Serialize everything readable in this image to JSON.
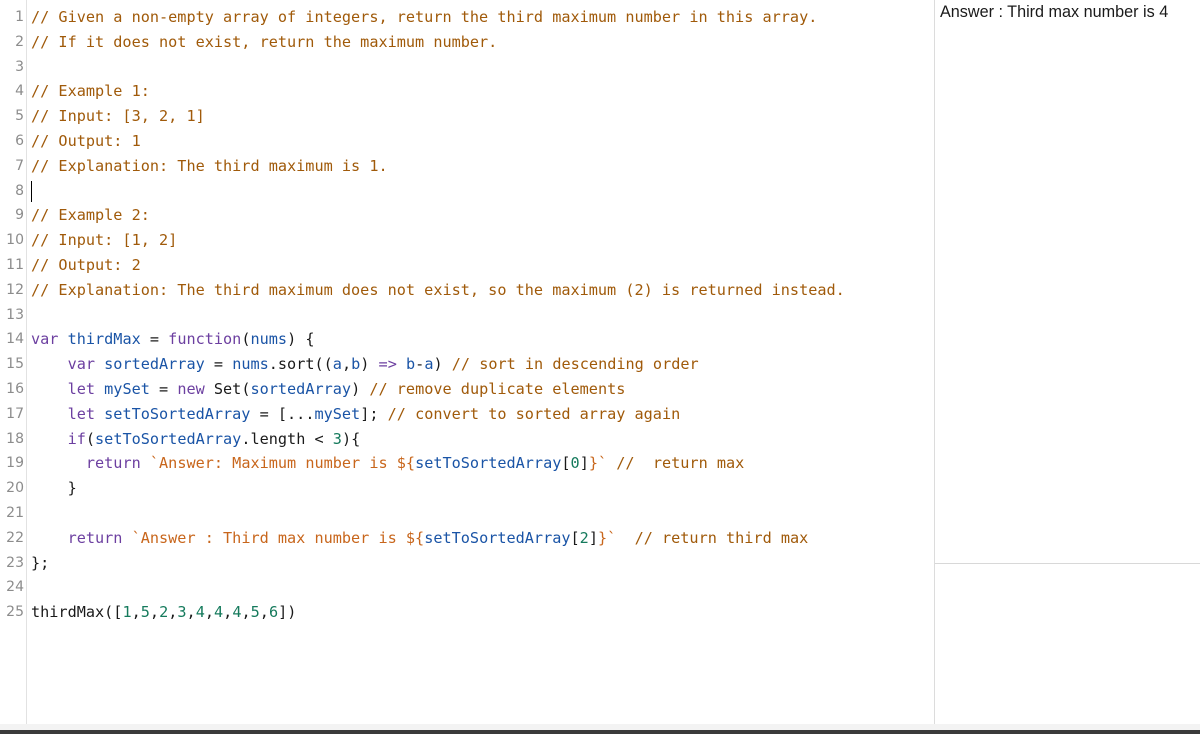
{
  "editor": {
    "lines": [
      {
        "n": "1",
        "parts": [
          {
            "t": "// Given a non-empty array of integers, return the third maximum number in this array.",
            "c": "cm"
          }
        ]
      },
      {
        "n": "2",
        "parts": [
          {
            "t": "// If it does not exist, return the maximum number.",
            "c": "cm"
          }
        ]
      },
      {
        "n": "3",
        "parts": []
      },
      {
        "n": "4",
        "parts": [
          {
            "t": "// Example 1:",
            "c": "cm"
          }
        ]
      },
      {
        "n": "5",
        "parts": [
          {
            "t": "// Input: [3, 2, 1]",
            "c": "cm"
          }
        ]
      },
      {
        "n": "6",
        "parts": [
          {
            "t": "// Output: 1",
            "c": "cm"
          }
        ]
      },
      {
        "n": "7",
        "parts": [
          {
            "t": "// Explanation: The third maximum is 1.",
            "c": "cm"
          }
        ]
      },
      {
        "n": "8",
        "parts": [],
        "cursor": true
      },
      {
        "n": "9",
        "parts": [
          {
            "t": "// Example 2:",
            "c": "cm"
          }
        ]
      },
      {
        "n": "10",
        "parts": [
          {
            "t": "// Input: [1, 2]",
            "c": "cm"
          }
        ]
      },
      {
        "n": "11",
        "parts": [
          {
            "t": "// Output: 2",
            "c": "cm"
          }
        ]
      },
      {
        "n": "12",
        "parts": [
          {
            "t": "// Explanation: The third maximum does not exist, so the maximum (2) is returned instead.",
            "c": "cm"
          }
        ]
      },
      {
        "n": "13",
        "parts": []
      },
      {
        "n": "14",
        "parts": [
          {
            "t": "var ",
            "c": "kw"
          },
          {
            "t": "thirdMax",
            "c": "vn"
          },
          {
            "t": " = ",
            "c": ""
          },
          {
            "t": "function",
            "c": "kw"
          },
          {
            "t": "(",
            "c": ""
          },
          {
            "t": "nums",
            "c": "vn"
          },
          {
            "t": ") {",
            "c": ""
          }
        ]
      },
      {
        "n": "15",
        "parts": [
          {
            "t": "    ",
            "c": ""
          },
          {
            "t": "var ",
            "c": "kw"
          },
          {
            "t": "sortedArray",
            "c": "vn"
          },
          {
            "t": " = ",
            "c": ""
          },
          {
            "t": "nums",
            "c": "vn"
          },
          {
            "t": ".sort((",
            "c": ""
          },
          {
            "t": "a",
            "c": "vn"
          },
          {
            "t": ",",
            "c": ""
          },
          {
            "t": "b",
            "c": "vn"
          },
          {
            "t": ") ",
            "c": ""
          },
          {
            "t": "=>",
            "c": "kw"
          },
          {
            "t": " ",
            "c": ""
          },
          {
            "t": "b",
            "c": "vn"
          },
          {
            "t": "-",
            "c": ""
          },
          {
            "t": "a",
            "c": "vn"
          },
          {
            "t": ") ",
            "c": ""
          },
          {
            "t": "// sort in descending order",
            "c": "cm"
          }
        ]
      },
      {
        "n": "16",
        "parts": [
          {
            "t": "    ",
            "c": ""
          },
          {
            "t": "let ",
            "c": "kw"
          },
          {
            "t": "mySet",
            "c": "vn"
          },
          {
            "t": " = ",
            "c": ""
          },
          {
            "t": "new ",
            "c": "kw"
          },
          {
            "t": "Set(",
            "c": ""
          },
          {
            "t": "sortedArray",
            "c": "vn"
          },
          {
            "t": ") ",
            "c": ""
          },
          {
            "t": "// remove duplicate elements",
            "c": "cm"
          }
        ]
      },
      {
        "n": "17",
        "parts": [
          {
            "t": "    ",
            "c": ""
          },
          {
            "t": "let ",
            "c": "kw"
          },
          {
            "t": "setToSortedArray",
            "c": "vn"
          },
          {
            "t": " = [...",
            "c": ""
          },
          {
            "t": "mySet",
            "c": "vn"
          },
          {
            "t": "]; ",
            "c": ""
          },
          {
            "t": "// convert to sorted array again",
            "c": "cm"
          }
        ]
      },
      {
        "n": "18",
        "parts": [
          {
            "t": "    ",
            "c": ""
          },
          {
            "t": "if",
            "c": "kw"
          },
          {
            "t": "(",
            "c": ""
          },
          {
            "t": "setToSortedArray",
            "c": "vn"
          },
          {
            "t": ".length < ",
            "c": ""
          },
          {
            "t": "3",
            "c": "nm"
          },
          {
            "t": "){",
            "c": ""
          }
        ]
      },
      {
        "n": "19",
        "parts": [
          {
            "t": "      ",
            "c": ""
          },
          {
            "t": "return ",
            "c": "kw"
          },
          {
            "t": "`Answer: Maximum number is ${",
            "c": "st"
          },
          {
            "t": "setToSortedArray",
            "c": "vn"
          },
          {
            "t": "[",
            "c": ""
          },
          {
            "t": "0",
            "c": "nm"
          },
          {
            "t": "]",
            "c": ""
          },
          {
            "t": "}`",
            "c": "st"
          },
          {
            "t": " //  return max",
            "c": "cm"
          }
        ]
      },
      {
        "n": "20",
        "parts": [
          {
            "t": "    }",
            "c": ""
          }
        ]
      },
      {
        "n": "21",
        "parts": []
      },
      {
        "n": "22",
        "parts": [
          {
            "t": "    ",
            "c": ""
          },
          {
            "t": "return ",
            "c": "kw"
          },
          {
            "t": "`Answer : Third max number is ${",
            "c": "st"
          },
          {
            "t": "setToSortedArray",
            "c": "vn"
          },
          {
            "t": "[",
            "c": ""
          },
          {
            "t": "2",
            "c": "nm"
          },
          {
            "t": "]",
            "c": ""
          },
          {
            "t": "}`",
            "c": "st"
          },
          {
            "t": "  // return third max",
            "c": "cm"
          }
        ]
      },
      {
        "n": "23",
        "parts": [
          {
            "t": "};",
            "c": ""
          }
        ]
      },
      {
        "n": "24",
        "parts": []
      },
      {
        "n": "25",
        "parts": [
          {
            "t": "thirdMax([",
            "c": ""
          },
          {
            "t": "1",
            "c": "nm"
          },
          {
            "t": ",",
            "c": ""
          },
          {
            "t": "5",
            "c": "nm"
          },
          {
            "t": ",",
            "c": ""
          },
          {
            "t": "2",
            "c": "nm"
          },
          {
            "t": ",",
            "c": ""
          },
          {
            "t": "3",
            "c": "nm"
          },
          {
            "t": ",",
            "c": ""
          },
          {
            "t": "4",
            "c": "nm"
          },
          {
            "t": ",",
            "c": ""
          },
          {
            "t": "4",
            "c": "nm"
          },
          {
            "t": ",",
            "c": ""
          },
          {
            "t": "4",
            "c": "nm"
          },
          {
            "t": ",",
            "c": ""
          },
          {
            "t": "5",
            "c": "nm"
          },
          {
            "t": ",",
            "c": ""
          },
          {
            "t": "6",
            "c": "nm"
          },
          {
            "t": "])",
            "c": ""
          }
        ]
      }
    ]
  },
  "output": {
    "text": "Answer : Third max number is 4"
  }
}
